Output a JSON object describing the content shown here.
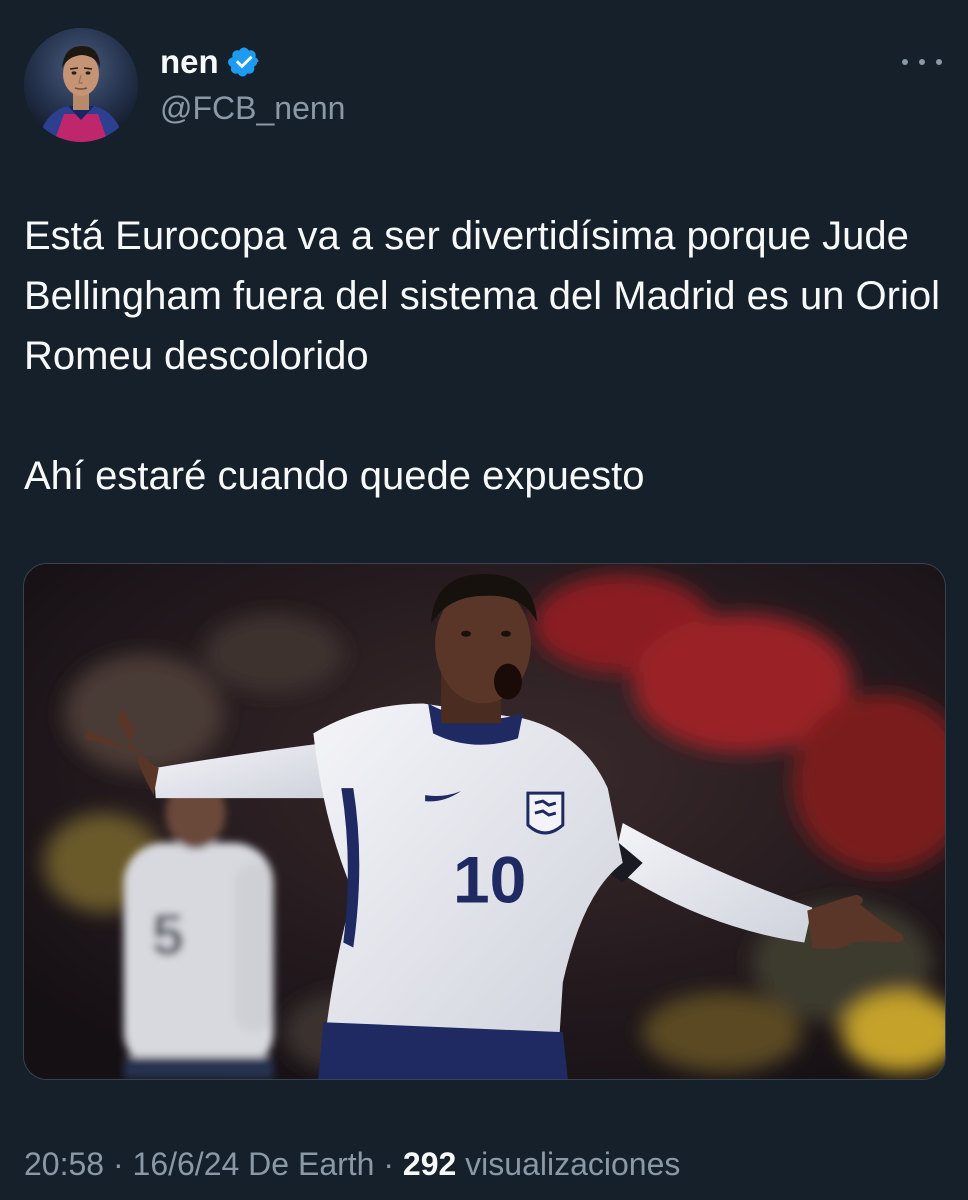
{
  "author": {
    "display_name": "nen",
    "handle": "@FCB_nenn",
    "verified": true,
    "avatar_icon": "profile-photo"
  },
  "tweet": {
    "text": "Está Eurocopa va a ser divertidísima porque Jude Bellingham fuera del sistema del Madrid es un Oriol Romeu descolorido\n\nAhí estaré cuando quede expuesto",
    "media": {
      "kind": "photo",
      "jersey_number_front": "10",
      "jersey_number_back": "5"
    }
  },
  "meta": {
    "time": "20:58",
    "separator": "·",
    "date": "16/6/24",
    "source": "De Earth",
    "views_count": "292",
    "views_label": "visualizaciones"
  },
  "colors": {
    "background": "#15202b",
    "text_primary": "#f7f9f9",
    "text_secondary": "#8b98a5",
    "verified_blue": "#1d9bf0"
  }
}
